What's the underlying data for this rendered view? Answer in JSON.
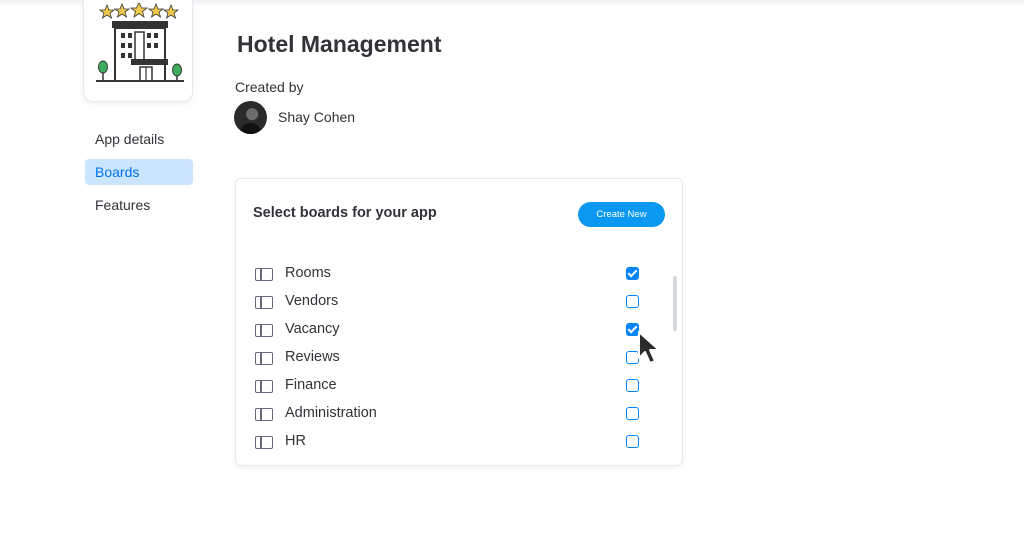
{
  "app": {
    "title": "Hotel Management",
    "created_by_label": "Created by",
    "creator": "Shay Cohen",
    "icon": "hotel-building-icon"
  },
  "nav": {
    "items": [
      {
        "label": "App details",
        "active": false
      },
      {
        "label": "Boards",
        "active": true
      },
      {
        "label": "Features",
        "active": false
      }
    ]
  },
  "boards": {
    "title": "Select boards for your app",
    "create_label": "Create New",
    "items": [
      {
        "name": "Rooms",
        "checked": true
      },
      {
        "name": "Vendors",
        "checked": false
      },
      {
        "name": "Vacancy",
        "checked": true
      },
      {
        "name": "Reviews",
        "checked": false
      },
      {
        "name": "Finance",
        "checked": false
      },
      {
        "name": "Administration",
        "checked": false
      },
      {
        "name": "HR",
        "checked": false
      }
    ]
  },
  "colors": {
    "accent": "#0085ff",
    "button": "#0a98f0",
    "nav_active_bg": "#cce5ff",
    "star": "#f2c94c"
  }
}
